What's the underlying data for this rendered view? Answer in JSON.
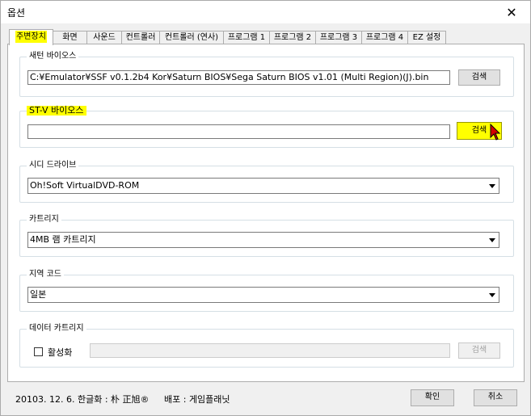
{
  "window": {
    "title": "옵션",
    "close_label": "✕"
  },
  "tabs": [
    {
      "label": "주변장치"
    },
    {
      "label": "화면"
    },
    {
      "label": "사운드"
    },
    {
      "label": "컨트롤러"
    },
    {
      "label": "컨트롤러 (연사)"
    },
    {
      "label": "프로그램 1"
    },
    {
      "label": "프로그램 2"
    },
    {
      "label": "프로그램 3"
    },
    {
      "label": "프로그램 4"
    },
    {
      "label": "EZ 설정"
    }
  ],
  "saturn_bios": {
    "label": "새턴 바이오스",
    "path": "C:¥Emulator¥SSF v0.1.2b4 Kor¥Saturn BIOS¥Sega Saturn BIOS v1.01 (Multi Region)(J).bin",
    "browse_label": "검색"
  },
  "stv_bios": {
    "label": "ST-V 바이오스",
    "path": "",
    "browse_label": "검색"
  },
  "cd_drive": {
    "label": "시디 드라이브",
    "selected": "Oh!Soft VirtualDVD-ROM"
  },
  "cartridge": {
    "label": "카트리지",
    "selected": "4MB 램 카트리지"
  },
  "region": {
    "label": "지역 코드",
    "selected": "일본"
  },
  "data_cartridge": {
    "label": "데이터 카트리지",
    "enable_label": "활성화",
    "enabled": false,
    "path": "",
    "browse_label": "검색"
  },
  "footer": {
    "credit": "20103. 12. 6.  한글화 : 朴 正旭®",
    "distribution": "배포 : 게임플래닛",
    "ok_label": "확인",
    "cancel_label": "취소"
  },
  "colors": {
    "highlight": "#ffff00",
    "cursor": "#d40000"
  }
}
